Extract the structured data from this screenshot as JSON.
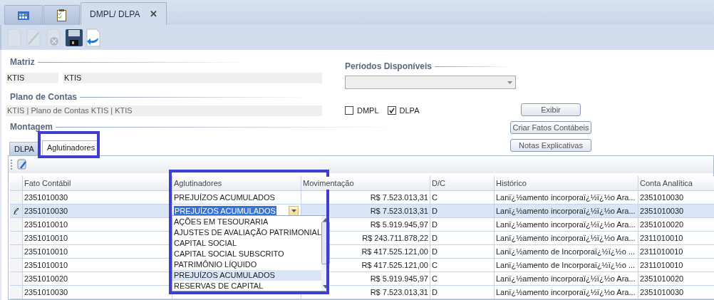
{
  "doc_tabs": [
    {
      "kind": "icon",
      "selected": false
    },
    {
      "kind": "icon",
      "selected": false
    },
    {
      "kind": "text",
      "label": "DMPL/ DLPA",
      "close": "✕",
      "selected": true
    }
  ],
  "toolbar": [
    {
      "disabled": true
    },
    {
      "disabled": true
    },
    {
      "disabled": true
    },
    {
      "disabled": false
    },
    {
      "disabled": false
    }
  ],
  "matriz": {
    "title": "Matriz",
    "code": "KTIS",
    "name": "KTIS"
  },
  "plano": {
    "title": "Plano de Contas",
    "value": "KTIS | Plano de Contas KTIS | KTIS"
  },
  "periodos": {
    "title": "Períodos Disponíveis"
  },
  "options": [
    {
      "label": "DMPL",
      "checked": false
    },
    {
      "label": "DLPA",
      "checked": true
    }
  ],
  "buttons": [
    "Exibir",
    "Criar Fatos Contábeis",
    "Notas Explicativas"
  ],
  "montagem": {
    "title": "Montagem",
    "tabs": [
      {
        "label": "DLPA",
        "selected": false
      },
      {
        "label": "Aglutinadores",
        "selected": true
      }
    ]
  },
  "table": {
    "columns": [
      "Fato Contábil",
      "Aglutinadores",
      "Movimentação",
      "D/C",
      "Histórico",
      "Conta Analítica"
    ],
    "rows": [
      {
        "editing": false,
        "selected": false,
        "cells": [
          "2351010030",
          "PREJUÍZOS ACUMULADOS",
          "R$ 7.523.013,31",
          "C",
          "Lanï¿½amento incorporaï¿½ï¿½o Ara...",
          "2351010030"
        ]
      },
      {
        "editing": true,
        "selected": true,
        "cells": [
          "2351010030",
          "PREJUÍZOS ACUMULADOS",
          "R$ 7.523.013,31",
          "D",
          "Lanï¿½amento incorporaï¿½ï¿½o Ara...",
          "2351010030"
        ]
      },
      {
        "editing": false,
        "selected": false,
        "cells": [
          "2351010010",
          null,
          "R$ 5.919.945,97",
          "D",
          "Lanï¿½amento incorporaï¿½ï¿½o Ara...",
          "2351010020"
        ]
      },
      {
        "editing": false,
        "selected": false,
        "cells": [
          "2351010010",
          null,
          "R$ 243.711.878,22",
          "D",
          "Lanï¿½amento incorporaï¿½ï¿½o Ara...",
          "2311010010"
        ]
      },
      {
        "editing": false,
        "selected": false,
        "cells": [
          "2351010010",
          null,
          "R$ 417.525.121,00",
          "D",
          "Lanï¿½amento de Incorporaï¿½ï¿½o ...",
          "2311010010"
        ]
      },
      {
        "editing": false,
        "selected": false,
        "cells": [
          "2351010010",
          null,
          "R$ 417.525.121,00",
          "C",
          "Lanï¿½amento de Incorporaï¿½ï¿½o ...",
          "2311010010"
        ]
      },
      {
        "editing": false,
        "selected": false,
        "cells": [
          "2351010020",
          null,
          "R$ 5.919.945,97",
          "C",
          "Lanï¿½amento incorporaï¿½ï¿½o Ara...",
          "2351010020"
        ]
      },
      {
        "editing": false,
        "selected": false,
        "cells": [
          "2351010030",
          null,
          "R$ 7.523.013,31",
          "D",
          "Lanï¿½amento incorporaï¿½ï¿½o Ara...",
          "2351010030"
        ]
      }
    ]
  },
  "dropdown": {
    "items": [
      {
        "label": "AÇÕES EM TESOURARIA",
        "selected": false
      },
      {
        "label": "AJUSTES DE AVALIAÇÃO PATRIMONIAL",
        "selected": false
      },
      {
        "label": "CAPITAL SOCIAL",
        "selected": false
      },
      {
        "label": "CAPITAL SOCIAL SUBSCRITO",
        "selected": false
      },
      {
        "label": "PATRIMÔNIO LÍQUIDO",
        "selected": false
      },
      {
        "label": "PREJUÍZOS ACUMULADOS",
        "selected": true
      },
      {
        "label": "RESERVAS DE CAPITAL",
        "selected": false
      }
    ]
  }
}
